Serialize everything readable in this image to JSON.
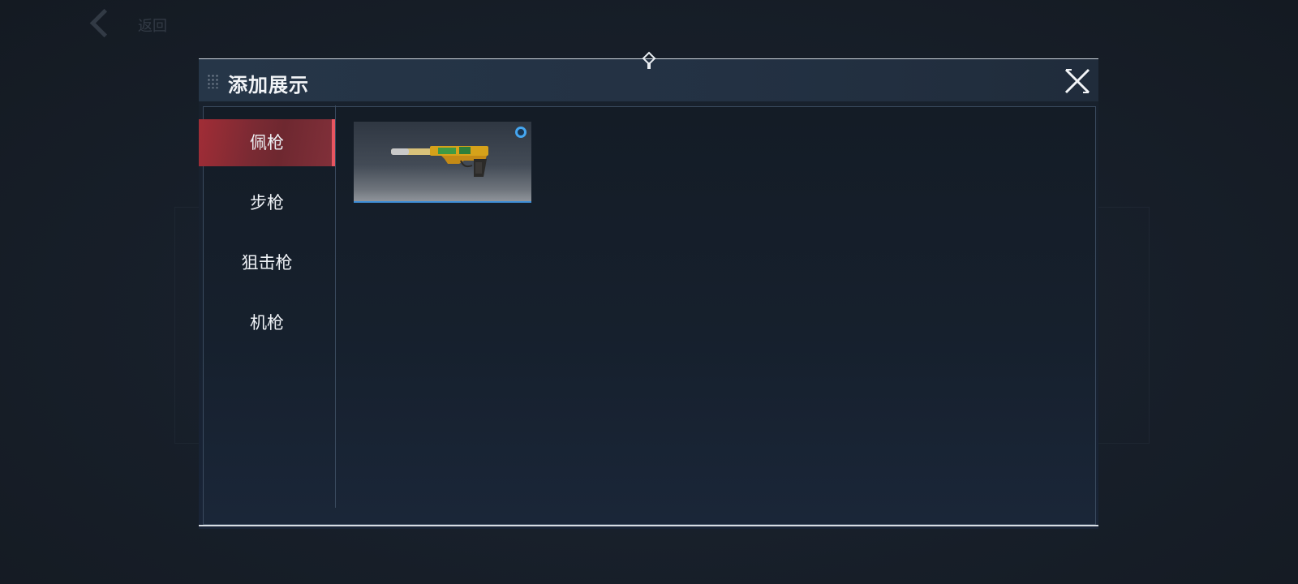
{
  "background": {
    "back_label": "返回"
  },
  "modal": {
    "title": "添加展示",
    "close_icon": "close-x-icon",
    "categories": [
      {
        "label": "佩枪",
        "active": true
      },
      {
        "label": "步枪",
        "active": false
      },
      {
        "label": "狙击枪",
        "active": false
      },
      {
        "label": "机枪",
        "active": false
      }
    ],
    "items": [
      {
        "icon": "pistol-weapon-icon",
        "quality_icon": "blue-ring-icon",
        "selected": true
      }
    ]
  },
  "colors": {
    "accent_red": "#a12d36",
    "accent_blue": "#45a6f0",
    "panel": "#172130"
  }
}
